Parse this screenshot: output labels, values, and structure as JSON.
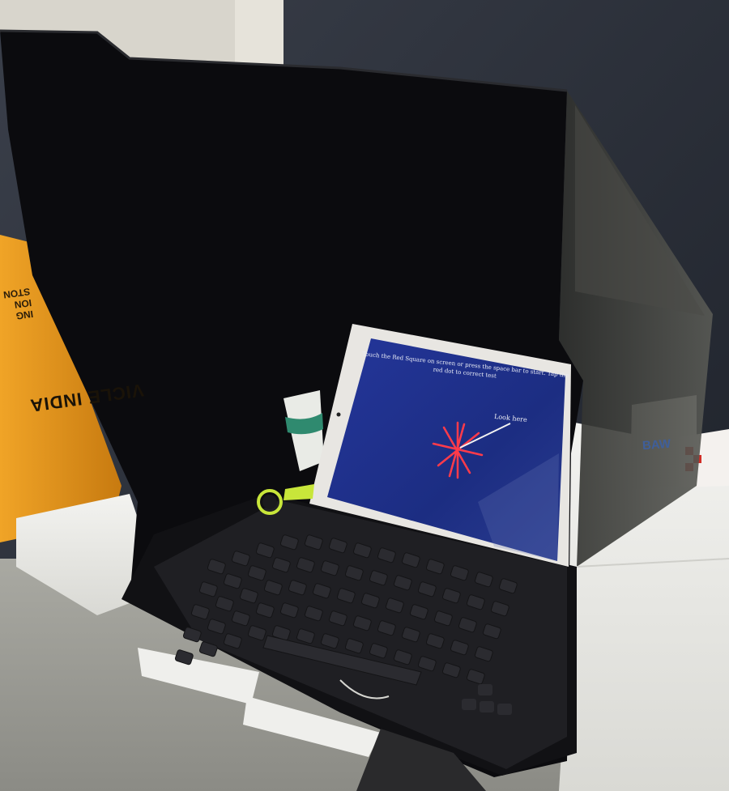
{
  "photo": {
    "screen_instruction": "Touch the Red Square on screen or press the space bar to start. Tap the red dot to correct test",
    "screen_pointer_label": "Look here",
    "box_text_main": "VICLE INDIA",
    "box_text_fragment": "ING\nION\nSTON",
    "side_box_text": "BAW"
  },
  "colors": {
    "screen_blue": "#1e2e86",
    "target_red": "#ff3b4a",
    "keyboard_accent": "#c8e63a",
    "hood_black": "#0b0b0e",
    "orange_box": "#e0901a"
  }
}
